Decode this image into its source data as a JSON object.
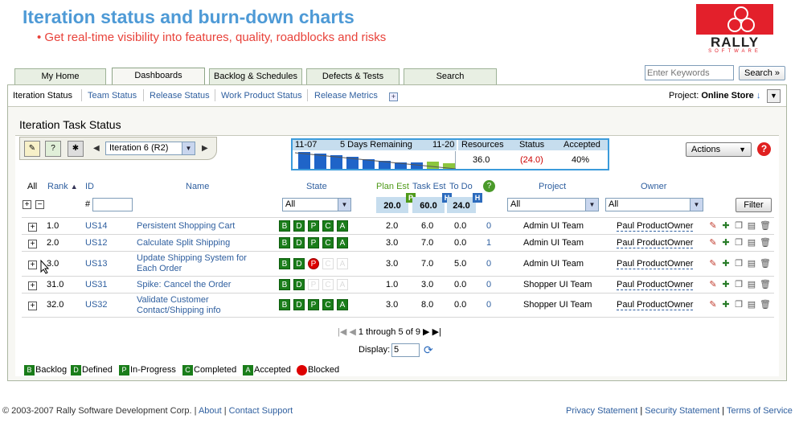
{
  "header": {
    "headline": "Iteration status and burn-down charts",
    "subline": "• Get real-time visibility into features, quality, roadblocks and risks",
    "logo_text": "RALLY",
    "logo_sub": "SOFTWARE"
  },
  "tabs": [
    "My Home",
    "Dashboards",
    "Backlog & Schedules",
    "Defects & Tests",
    "Search"
  ],
  "active_tab": "Dashboards",
  "search": {
    "placeholder": "Enter Keywords",
    "button": "Search »"
  },
  "subnav": {
    "items": [
      "Iteration Status",
      "Team Status",
      "Release Status",
      "Work Product Status",
      "Release Metrics"
    ],
    "add": "+",
    "project_label": "Project:",
    "project_value": "Online Store"
  },
  "page_title": "Iteration Task Status",
  "iteration": {
    "selected": "Iteration 6 (R2)"
  },
  "burn": {
    "start": "11-07",
    "remaining": "5 Days Remaining",
    "end": "11-20",
    "resources_label": "Resources",
    "status_label": "Status",
    "accepted_label": "Accepted",
    "resources": "36.0",
    "status": "(24.0)",
    "accepted": "40%",
    "bars": [
      0.95,
      0.85,
      0.75,
      0.68,
      0.55,
      0.45,
      0.35,
      0.38,
      0.4,
      0.3
    ]
  },
  "actions_label": "Actions",
  "help": "?",
  "columns": {
    "all": "All",
    "rank": "Rank",
    "id": "ID",
    "name": "Name",
    "state": "State",
    "plan_est": "Plan Est",
    "task_est": "Task Est",
    "to_do": "To Do",
    "project": "Project",
    "owner": "Owner",
    "id_prefix": "#"
  },
  "totals": {
    "plan_est": "20.0",
    "task_est": "60.0",
    "to_do": "24.0",
    "flag_p": "P",
    "flag_h": "H"
  },
  "filters": {
    "state": "All",
    "project": "All",
    "owner": "All",
    "button": "Filter"
  },
  "state_letters": [
    "B",
    "D",
    "P",
    "C",
    "A"
  ],
  "rows": [
    {
      "rank": "1.0",
      "id": "US14",
      "name": [
        "Persistent Shopping Cart"
      ],
      "states": [
        "f",
        "f",
        "f",
        "f",
        "f"
      ],
      "plan": "2.0",
      "task": "6.0",
      "todo": "0.0",
      "defects": "0",
      "project": "Admin UI Team",
      "owner": "Paul ProductOwner"
    },
    {
      "rank": "2.0",
      "id": "US12",
      "name": [
        "Calculate Split Shipping"
      ],
      "states": [
        "f",
        "f",
        "f",
        "f",
        "f"
      ],
      "plan": "3.0",
      "task": "7.0",
      "todo": "0.0",
      "defects": "1",
      "project": "Admin UI Team",
      "owner": "Paul ProductOwner"
    },
    {
      "rank": "3.0",
      "id": "US13",
      "name": [
        "Update Shipping System for",
        "Each Order"
      ],
      "states": [
        "f",
        "f",
        "b",
        "e",
        "e"
      ],
      "plan": "3.0",
      "task": "7.0",
      "todo": "5.0",
      "defects": "0",
      "project": "Admin UI Team",
      "owner": "Paul ProductOwner"
    },
    {
      "rank": "31.0",
      "id": "US31",
      "name": [
        "Spike: Cancel the Order"
      ],
      "states": [
        "f",
        "f",
        "e",
        "e",
        "e"
      ],
      "plan": "1.0",
      "task": "3.0",
      "todo": "0.0",
      "defects": "0",
      "project": "Shopper UI Team",
      "owner": "Paul ProductOwner"
    },
    {
      "rank": "32.0",
      "id": "US32",
      "name": [
        "Validate Customer",
        "Contact/Shipping info"
      ],
      "states": [
        "f",
        "f",
        "f",
        "f",
        "f"
      ],
      "plan": "3.0",
      "task": "8.0",
      "todo": "0.0",
      "defects": "0",
      "project": "Shopper UI Team",
      "owner": "Paul ProductOwner"
    }
  ],
  "pager": {
    "text": "1 through 5 of 9",
    "display_label": "Display:",
    "display_value": "5"
  },
  "legend": [
    {
      "key": "B",
      "label": "Backlog"
    },
    {
      "key": "D",
      "label": "Defined"
    },
    {
      "key": "P",
      "label": "In-Progress"
    },
    {
      "key": "C",
      "label": "Completed"
    },
    {
      "key": "A",
      "label": "Accepted"
    },
    {
      "key": "",
      "label": "Blocked"
    }
  ],
  "footer": {
    "copyright": "© 2003-2007 Rally Software Development Corp.",
    "about": "About",
    "contact": "Contact Support",
    "privacy": "Privacy Statement",
    "security": "Security Statement",
    "terms": "Terms of Service",
    "sep": "|"
  },
  "colors": {
    "accent": "#2f5f9f",
    "green": "#1a7d1a",
    "blocked": "#dd0000",
    "headline": "#4e9ad6",
    "subline": "#e8423a"
  }
}
